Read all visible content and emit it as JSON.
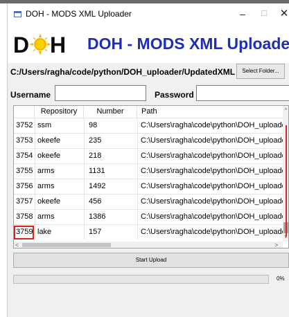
{
  "window": {
    "title": "DOH - MODS XML Uploader",
    "controls": {
      "minimize": "–",
      "maximize": "☐",
      "close": "✕"
    }
  },
  "header": {
    "logo_left": "D",
    "logo_right": "H",
    "heading": "DOH - MODS XML Uploader",
    "heading_color": "#1f2fb5"
  },
  "folder": {
    "path": "C:/Users/ragha/code/python/DOH_uploader/UpdatedXML",
    "select_label": "Select Folder..."
  },
  "credentials": {
    "username_label": "Username",
    "username_value": "",
    "password_label": "Password",
    "password_value": ""
  },
  "table": {
    "columns": [
      "Repository",
      "Number",
      "Path"
    ],
    "rows": [
      {
        "index": "3752",
        "repository": "ssm",
        "number": "98",
        "path": "C:\\Users\\ragha\\code\\python\\DOH_uploader"
      },
      {
        "index": "3753",
        "repository": "okeefe",
        "number": "235",
        "path": "C:\\Users\\ragha\\code\\python\\DOH_uploader"
      },
      {
        "index": "3754",
        "repository": "okeefe",
        "number": "218",
        "path": "C:\\Users\\ragha\\code\\python\\DOH_uploader"
      },
      {
        "index": "3755",
        "repository": "arms",
        "number": "1131",
        "path": "C:\\Users\\ragha\\code\\python\\DOH_uploader"
      },
      {
        "index": "3756",
        "repository": "arms",
        "number": "1492",
        "path": "C:\\Users\\ragha\\code\\python\\DOH_uploader"
      },
      {
        "index": "3757",
        "repository": "okeefe",
        "number": "456",
        "path": "C:\\Users\\ragha\\code\\python\\DOH_uploader"
      },
      {
        "index": "3758",
        "repository": "arms",
        "number": "1386",
        "path": "C:\\Users\\ragha\\code\\python\\DOH_uploader"
      },
      {
        "index": "3759",
        "repository": "lake",
        "number": "157",
        "path": "C:\\Users\\ragha\\code\\python\\DOH_uploader"
      }
    ],
    "highlighted_index": "3759",
    "highlight_color": "#e0201d",
    "scroll": {
      "up": "^",
      "down": "v",
      "left": "<",
      "right": ">"
    }
  },
  "upload": {
    "start_label": "Start Upload",
    "progress_value": 0,
    "progress_text": "0%"
  }
}
